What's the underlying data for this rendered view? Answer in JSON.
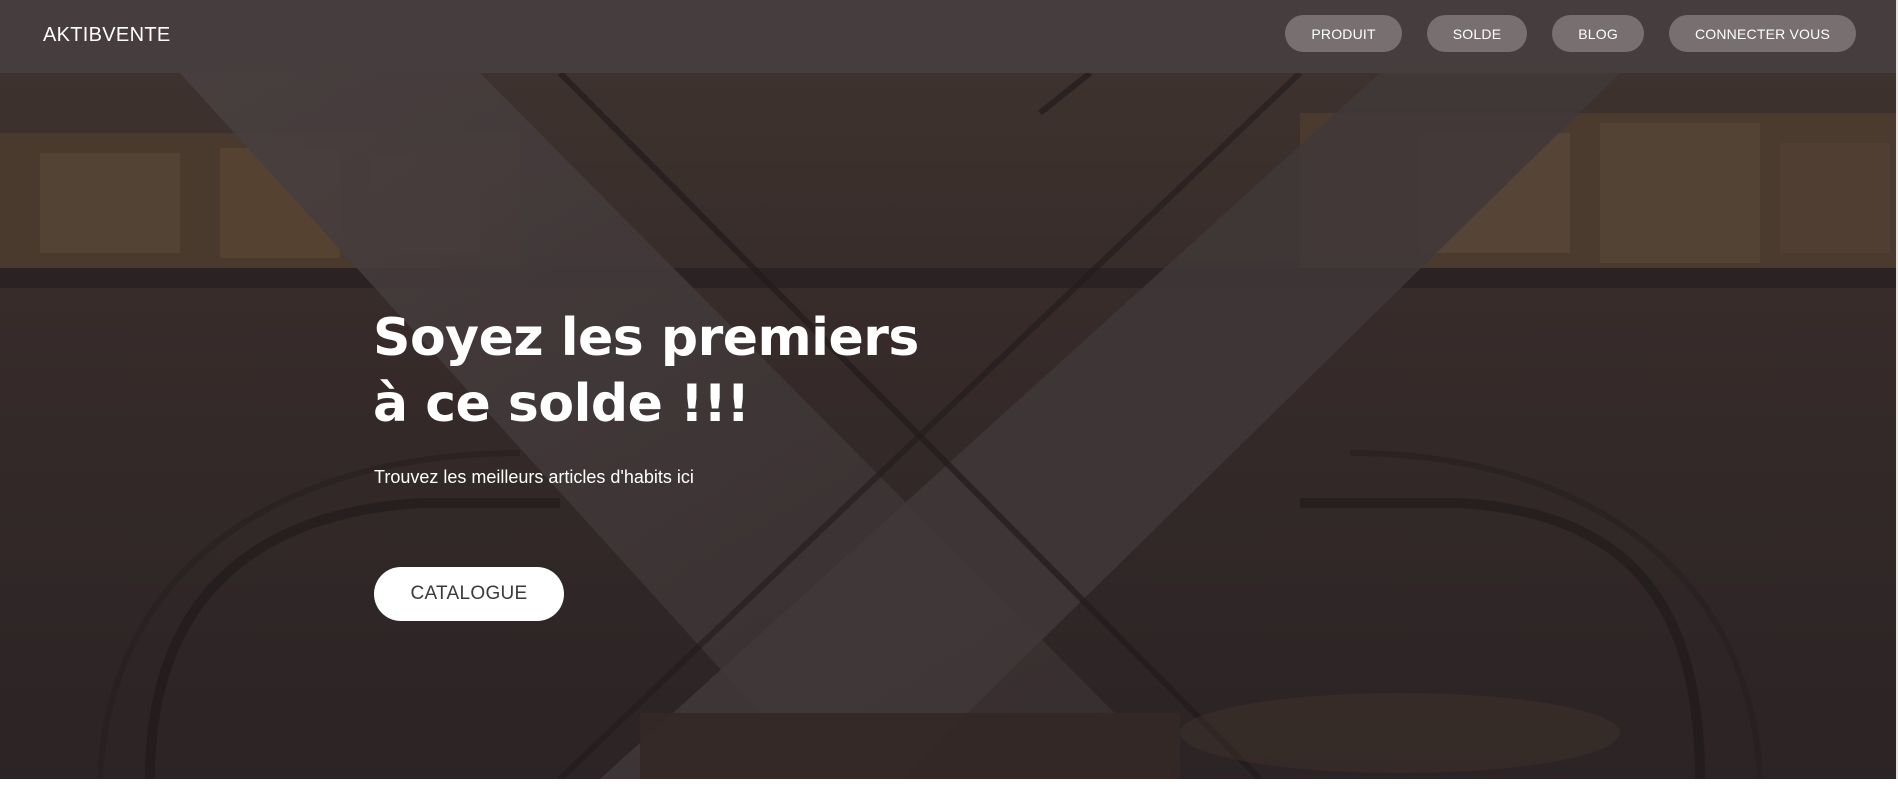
{
  "navbar": {
    "brand": "AKTIBVENTE",
    "links": [
      {
        "label": "PRODUIT"
      },
      {
        "label": "SOLDE"
      },
      {
        "label": "BLOG"
      },
      {
        "label": "CONNECTER VOUS"
      }
    ]
  },
  "hero": {
    "title": "Soyez les premiers à ce solde !!!",
    "subtitle": "Trouvez les meilleurs articles d'habits ici",
    "cta_label": "CATALOGUE",
    "background_scene": "mall escalator photo"
  },
  "colors": {
    "navbar_bg": "#463d3e",
    "nav_button_bg": "#776f70",
    "hero_overlay": "#3a3233",
    "cta_bg": "#ffffff"
  }
}
